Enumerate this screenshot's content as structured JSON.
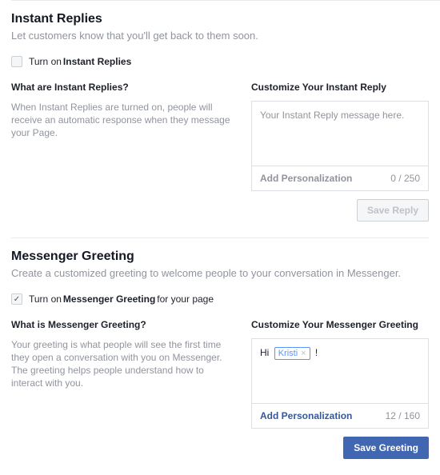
{
  "instantReplies": {
    "title": "Instant Replies",
    "subtitle": "Let customers know that you'll get back to them soon.",
    "toggle": {
      "prefix": "Turn on ",
      "bold": "Instant Replies",
      "checked": false
    },
    "whatHeading": "What are Instant Replies?",
    "whatDesc": "When Instant Replies are turned on, people will receive an automatic response when they message your Page.",
    "customizeHeading": "Customize Your Instant Reply",
    "placeholder": "Your Instant Reply message here.",
    "addPersonalization": "Add Personalization",
    "counter": "0 / 250",
    "saveLabel": "Save Reply"
  },
  "messengerGreeting": {
    "title": "Messenger Greeting",
    "subtitle": "Create a customized greeting to welcome people to your conversation in Messenger.",
    "toggle": {
      "prefix": "Turn on ",
      "bold": "Messenger Greeting",
      "suffix": " for your page",
      "checked": true
    },
    "whatHeading": "What is Messenger Greeting?",
    "whatDesc": "Your greeting is what people will see the first time they open a conversation with you on Messenger. The greeting helps people understand how to interact with you.",
    "customizeHeading": "Customize Your Messenger Greeting",
    "greetingPrefix": "Hi",
    "tokenLabel": "Kristi",
    "greetingSuffix": "!",
    "addPersonalization": "Add Personalization",
    "counter": "12 / 160",
    "saveLabel": "Save Greeting"
  }
}
